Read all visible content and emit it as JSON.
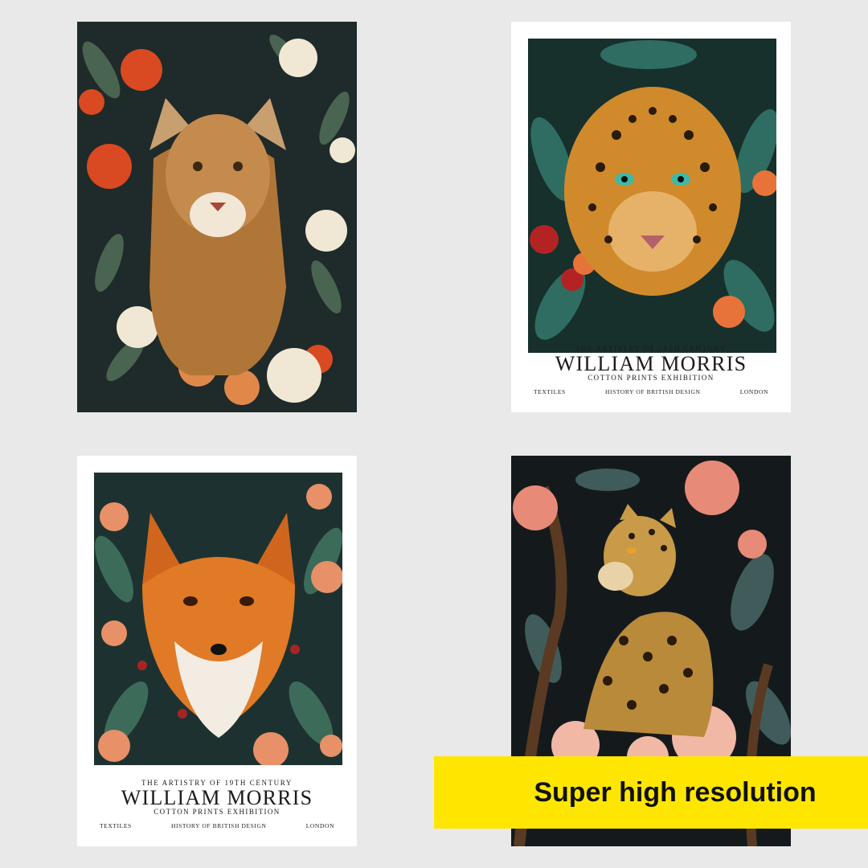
{
  "posters": [
    {
      "subject": "cougar"
    },
    {
      "subject": "leopard-face",
      "caption": {
        "eyebrow": "THE ARTISTRY OF 19TH CENTURY",
        "title": "WILLIAM MORRIS",
        "subtitle": "COTTON PRINTS EXHIBITION",
        "footer_left": "TEXTILES",
        "footer_center": "HISTORY OF BRITISH DESIGN",
        "footer_right": "LONDON"
      }
    },
    {
      "subject": "fox",
      "caption": {
        "eyebrow": "THE ARTISTRY OF 19TH CENTURY",
        "title": "WILLIAM MORRIS",
        "subtitle": "COTTON PRINTS EXHIBITION",
        "footer_left": "TEXTILES",
        "footer_center": "HISTORY OF BRITISH DESIGN",
        "footer_right": "LONDON"
      }
    },
    {
      "subject": "seated-leopard"
    }
  ],
  "banner": {
    "text": "Super high resolution",
    "color": "#ffe600"
  }
}
